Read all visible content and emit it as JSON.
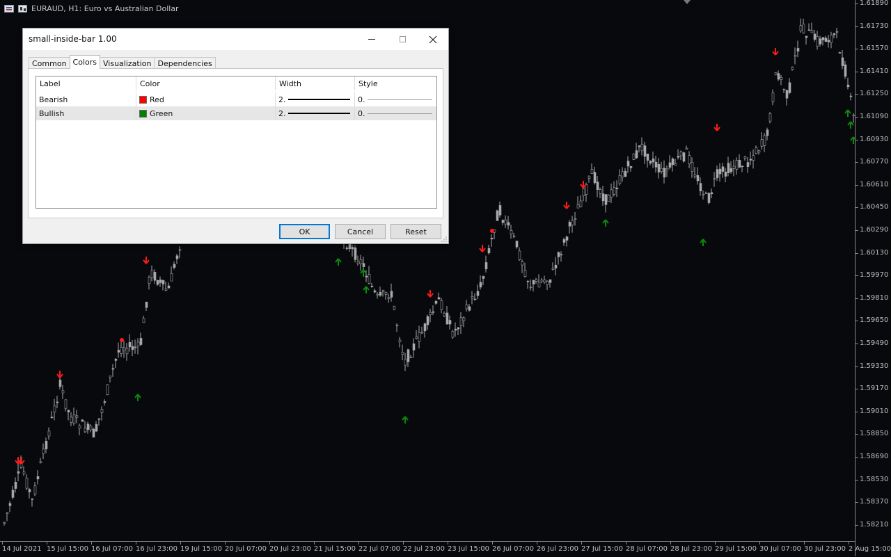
{
  "chart": {
    "title": "EURAUD, H1:  Euro vs Australian Dollar",
    "price_labels": [
      "1.61890",
      "1.61730",
      "1.61570",
      "1.61410",
      "1.61250",
      "1.61090",
      "1.60930",
      "1.60770",
      "1.60610",
      "1.60450",
      "1.60290",
      "1.60130",
      "1.59970",
      "1.59810",
      "1.59650",
      "1.59490",
      "1.59330",
      "1.59170",
      "1.59010",
      "1.58850",
      "1.58690",
      "1.58530",
      "1.58370",
      "1.58210"
    ],
    "time_labels": [
      "14 Jul 2021",
      "15 Jul 15:00",
      "16 Jul 07:00",
      "16 Jul 23:00",
      "19 Jul 15:00",
      "20 Jul 07:00",
      "20 Jul 23:00",
      "21 Jul 15:00",
      "22 Jul 07:00",
      "22 Jul 23:00",
      "23 Jul 15:00",
      "26 Jul 07:00",
      "26 Jul 23:00",
      "27 Jul 15:00",
      "28 Jul 07:00",
      "28 Jul 23:00",
      "29 Jul 15:00",
      "30 Jul 07:00",
      "30 Jul 23:00",
      "2 Aug 15:00"
    ],
    "colors": {
      "background": "#08090d",
      "candle": "#a9a9a9",
      "bearish": "#ff1a1a",
      "bullish": "#0a8a0a",
      "axis_text": "#bfbfbf"
    }
  },
  "dialog": {
    "title": "small-inside-bar 1.00",
    "tabs": [
      {
        "label": "Common"
      },
      {
        "label": "Colors"
      },
      {
        "label": "Visualization"
      },
      {
        "label": "Dependencies"
      }
    ],
    "active_tab": "Colors",
    "columns": {
      "label": "Label",
      "color": "Color",
      "width": "Width",
      "style": "Style"
    },
    "rows": [
      {
        "label": "Bearish",
        "color_name": "Red",
        "color_hex": "#ff0000",
        "width": "2.",
        "style": "0."
      },
      {
        "label": "Bullish",
        "color_name": "Green",
        "color_hex": "#008000",
        "width": "2.",
        "style": "0."
      }
    ],
    "buttons": {
      "ok": "OK",
      "cancel": "Cancel",
      "reset": "Reset"
    }
  }
}
